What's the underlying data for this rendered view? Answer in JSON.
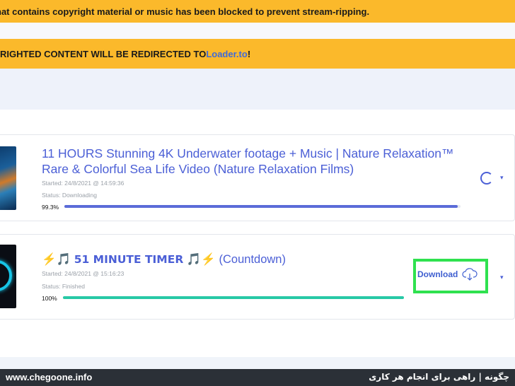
{
  "banners": {
    "blocked_text": "hat contains copyright material or music has been blocked to prevent stream-ripping.",
    "redirect_text": "RIGHTED CONTENT WILL BE REDIRECTED TO ",
    "redirect_link": "Loader.to",
    "redirect_suffix": "!"
  },
  "items": [
    {
      "title": "11 HOURS Stunning 4K Underwater footage + Music | Nature Relaxation™ Rare & Colorful Sea Life Video (Nature Relaxation Films)",
      "started": "Started: 24/8/2021 @ 14:59:36",
      "status": "Status: Downloading",
      "progress_label": "99.3%",
      "progress": 0.993,
      "bar_color": "#5b6bd8"
    },
    {
      "title_prefix": "⚡🎵 ",
      "title_bold": "51 MINUTE TIMER",
      "title_suffix": " 🎵⚡ (Countdown)",
      "started": "Started: 24/8/2021 @ 15:16:23",
      "status": "Status: Finished",
      "progress_label": "100%",
      "progress": 1.0,
      "bar_color": "#27c9a6",
      "download_label": "Download"
    }
  ],
  "footer": {
    "site": "www.chegoone.info",
    "tagline": "چگونه | راهی برای انجام هر کاری"
  },
  "colors": {
    "accent": "#4b5fd6",
    "banner": "#fbb92b",
    "highlight": "#2fe14f"
  }
}
